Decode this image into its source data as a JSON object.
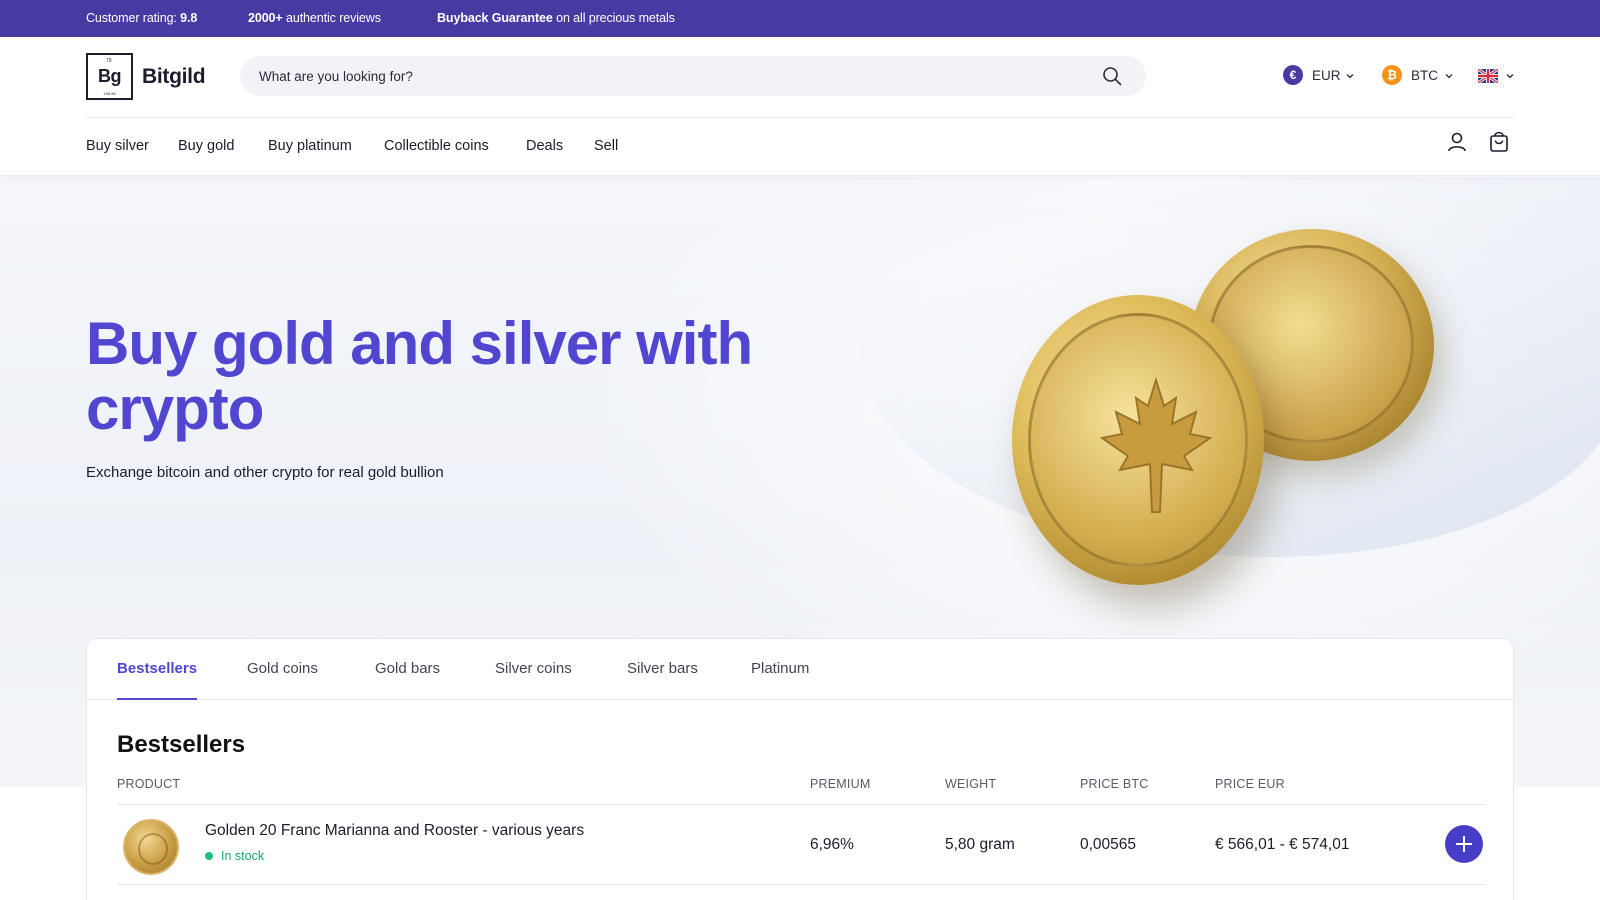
{
  "topbar": {
    "rating_label": "Customer rating:",
    "rating_value": "9.8",
    "reviews_count": "2000+",
    "reviews_label": "authentic reviews",
    "guarantee_bold": "Buyback Guarantee",
    "guarantee_rest": "on all precious metals"
  },
  "logo": {
    "symbol": "Bg",
    "atomic_number": "79",
    "mass": "196.96",
    "name": "Bitgild"
  },
  "search": {
    "placeholder": "What are you looking for?",
    "icon": "search-icon"
  },
  "currency": {
    "symbol": "€",
    "code": "EUR",
    "color": "#473ba3"
  },
  "crypto": {
    "symbol": "₿",
    "code": "BTC",
    "color": "#f7931a"
  },
  "language": {
    "icon": "uk-flag-icon"
  },
  "nav": [
    "Buy silver",
    "Buy gold",
    "Buy platinum",
    "Collectible coins",
    "Deals",
    "Sell"
  ],
  "header_icons": [
    "user-icon",
    "shopping-bag-icon"
  ],
  "hero": {
    "title": "Buy gold and silver with crypto",
    "subtitle": "Exchange bitcoin and other crypto for real gold bullion"
  },
  "tabs": [
    "Bestsellers",
    "Gold coins",
    "Gold bars",
    "Silver coins",
    "Silver bars",
    "Platinum"
  ],
  "active_tab": "Bestsellers",
  "section_title": "Bestsellers",
  "table": {
    "headers": [
      "PRODUCT",
      "PREMIUM",
      "WEIGHT",
      "PRICE BTC",
      "PRICE EUR"
    ],
    "rows": [
      {
        "name": "Golden 20 Franc Marianna and Rooster - various years",
        "stock": "In stock",
        "premium": "6,96%",
        "weight": "5,80 gram",
        "price_btc": "0,00565",
        "price_eur": "€ 566,01 - € 574,01"
      }
    ]
  },
  "colors": {
    "brand": "#473ba3",
    "accent": "#5146cf",
    "in_stock": "#1aa56a"
  }
}
